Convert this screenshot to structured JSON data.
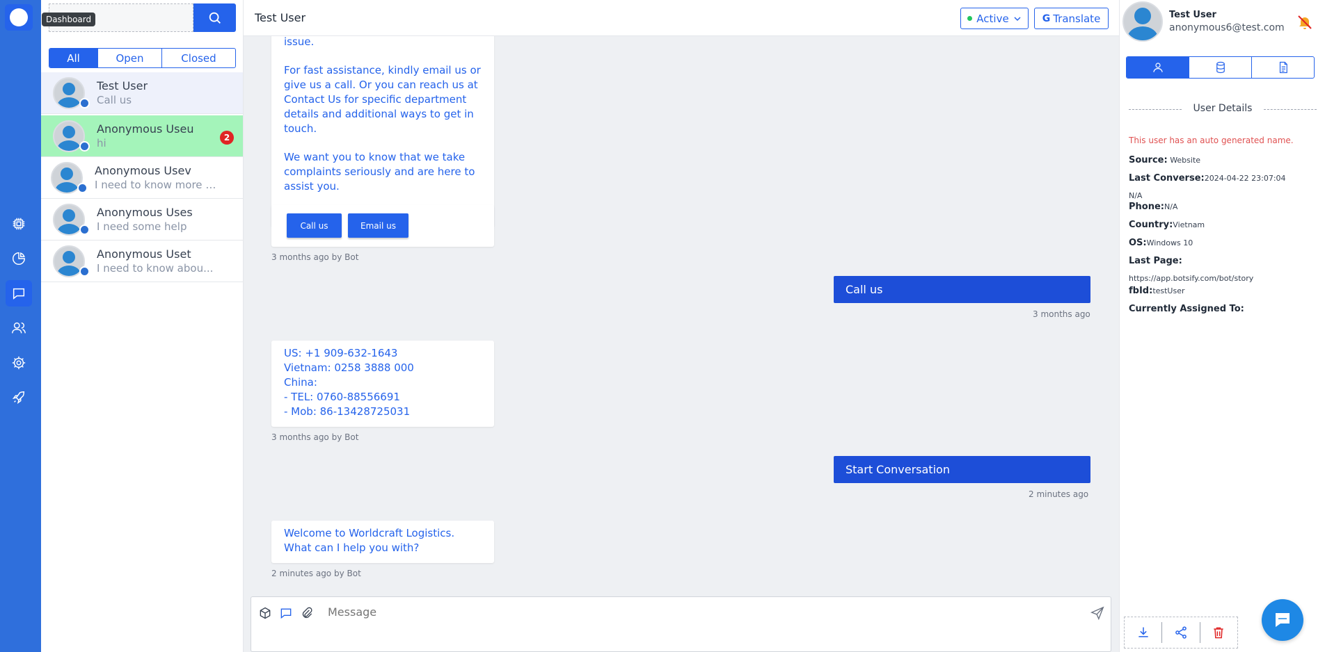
{
  "rail": {
    "tooltip": "Dashboard",
    "items": [
      "chip",
      "analytics",
      "chat",
      "users",
      "settings",
      "rocket"
    ]
  },
  "search": {
    "placeholder": ""
  },
  "filters": [
    "All",
    "Open",
    "Closed"
  ],
  "conversations": [
    {
      "name": "Test User",
      "snippet": "Call us"
    },
    {
      "name": "Anonymous Useu",
      "snippet": "hi",
      "unread": "2"
    },
    {
      "name": "Anonymous Usev",
      "snippet": "I need to know more ab..."
    },
    {
      "name": "Anonymous Uses",
      "snippet": "I need some help"
    },
    {
      "name": "Anonymous Uset",
      "snippet": "I need to know abou..."
    }
  ],
  "header": {
    "title": "Test User",
    "status": "Active",
    "translate": "Translate"
  },
  "messages": {
    "bot1": {
      "p1": "issue.",
      "p2": "For fast assistance, kindly email us or give us a call. Or you can reach us at Contact Us for specific department details and additional ways to get in touch.",
      "p3": "We want you to know that we take complaints seriously and are here to assist you."
    },
    "buttons": [
      "Call us",
      "Email us"
    ],
    "bot1_meta": "3 months ago by Bot",
    "user1": "Call us",
    "user1_meta": "3 months ago",
    "bot2": [
      "US: +1 909-632-1643",
      "Vietnam: 0258 3888 000",
      "China:",
      "- TEL: 0760-88556691",
      "- Mob: 86-13428725031"
    ],
    "bot2_meta": "3 months ago by Bot",
    "user2": "Start Conversation",
    "user2_meta": "2 minutes ago",
    "bot3": "Welcome to Worldcraft Logistics. What can I help you with?",
    "bot3_meta": "2 minutes ago by Bot"
  },
  "composer": {
    "placeholder": "Message"
  },
  "details": {
    "name": "Test User",
    "email": "anonymous6@test.com",
    "section_title": "User Details",
    "warning": "This user has an auto generated name.",
    "source_label": "Source:",
    "source": "Website",
    "last_converse_label": "Last Converse:",
    "last_converse": "2024-04-22 23:07:04",
    "na": "N/A",
    "phone_label": "Phone:",
    "phone": "N/A",
    "country_label": "Country:",
    "country": "Vietnam",
    "os_label": "OS:",
    "os": "Windows 10",
    "last_page_label": "Last Page:",
    "last_page": "https://app.botsify.com/bot/story",
    "fbid_label": "fbId:",
    "fbid": "testUser",
    "assigned_label": "Currently Assigned To:"
  },
  "colors": {
    "accent": "#2563eb",
    "rail": "#2f6fdc",
    "unread_row": "#a4f4ba",
    "badge": "#e02424",
    "warning": "#e05252"
  }
}
